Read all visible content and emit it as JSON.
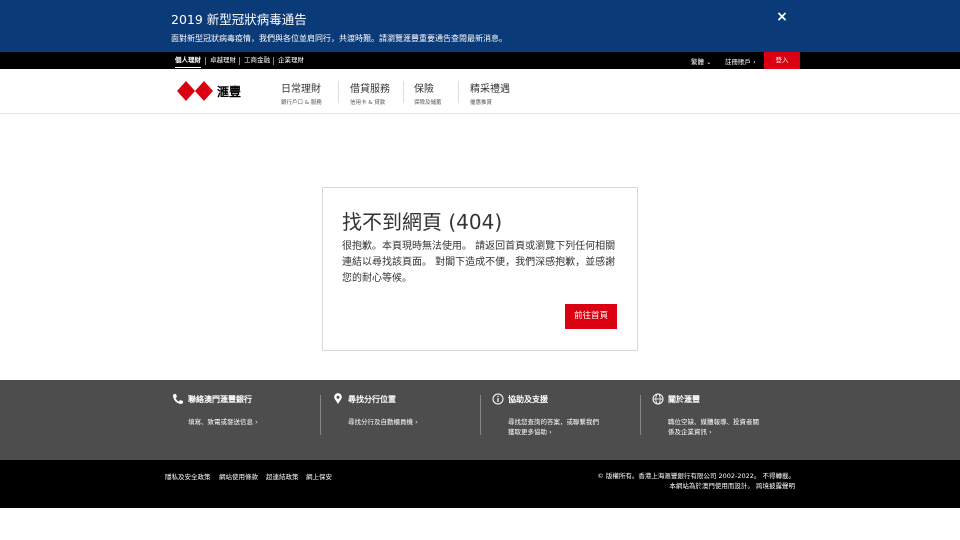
{
  "alert": {
    "title": "2019 新型冠狀病毒通告",
    "message": "面對新型冠狀病毒疫情，我們與各位並肩同行，共渡時艱。請瀏覽滙豐重要通告查閱最新消息。",
    "close_icon": "×"
  },
  "topbar": {
    "segments": [
      "個人理財",
      "卓越理財",
      "工商金融",
      "企業理財"
    ],
    "language": "繁體",
    "register": "註冊賬戶",
    "login": "登入"
  },
  "brand": {
    "name": "滙豐"
  },
  "nav": [
    {
      "label": "日常理財",
      "sub": "銀行戶口 & 服務"
    },
    {
      "label": "借貸服務",
      "sub": "信用卡 & 貸款"
    },
    {
      "label": "保險",
      "sub": "保險及儲蓄"
    },
    {
      "label": "精采禮遇",
      "sub": "優惠推賞"
    }
  ],
  "error": {
    "title": "找不到網頁 (404)",
    "message": "很抱歉。本頁現時無法使用。 請返回首頁或瀏覽下列任何相關連結以尋找該頁面。 對閣下造成不便，我們深感抱歉，並感謝您的耐心等候。",
    "button": "前往首頁"
  },
  "footer": {
    "columns": [
      {
        "title": "聯絡澳門滙豐銀行",
        "link": "填寫、致電或發送信息 ›",
        "icon": "phone-icon"
      },
      {
        "title": "尋找分行位置",
        "link": "尋找分行及自動櫃員機 ›",
        "icon": "location-pin-icon"
      },
      {
        "title": "協助及支援",
        "link1": "尋找您查詢的答案，或聯繫我們",
        "link2": "獲取更多協助 ›",
        "icon": "info-icon"
      },
      {
        "title": "關於滙豐",
        "link1": "職位空缺、媒體報導、投資者關",
        "link2": "係及企業資訊 ›",
        "icon": "globe-icon"
      }
    ]
  },
  "bottom": {
    "links": [
      "隱私及安全政策",
      "網站使用條款",
      "超連結政策",
      "網上保安"
    ],
    "copyright": "© 版權所有。香港上海滙豐銀行有限公司 2002-2022。 不得轉載。",
    "design_note": "本網站為於澳門使用而設計。 跨境披露聲明"
  },
  "colors": {
    "brand_red": "#db0011",
    "alert_blue": "#0b3a78",
    "footer_grey": "#4d4d4d"
  }
}
